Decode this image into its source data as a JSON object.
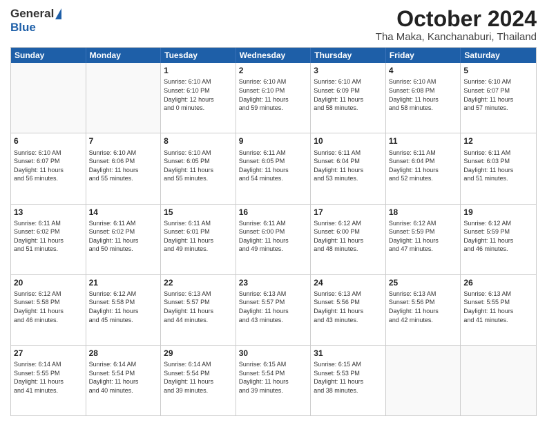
{
  "logo": {
    "general": "General",
    "blue": "Blue"
  },
  "header": {
    "month": "October 2024",
    "location": "Tha Maka, Kanchanaburi, Thailand"
  },
  "weekdays": [
    "Sunday",
    "Monday",
    "Tuesday",
    "Wednesday",
    "Thursday",
    "Friday",
    "Saturday"
  ],
  "weeks": [
    [
      {
        "day": "",
        "info": ""
      },
      {
        "day": "",
        "info": ""
      },
      {
        "day": "1",
        "info": "Sunrise: 6:10 AM\nSunset: 6:10 PM\nDaylight: 12 hours\nand 0 minutes."
      },
      {
        "day": "2",
        "info": "Sunrise: 6:10 AM\nSunset: 6:10 PM\nDaylight: 11 hours\nand 59 minutes."
      },
      {
        "day": "3",
        "info": "Sunrise: 6:10 AM\nSunset: 6:09 PM\nDaylight: 11 hours\nand 58 minutes."
      },
      {
        "day": "4",
        "info": "Sunrise: 6:10 AM\nSunset: 6:08 PM\nDaylight: 11 hours\nand 58 minutes."
      },
      {
        "day": "5",
        "info": "Sunrise: 6:10 AM\nSunset: 6:07 PM\nDaylight: 11 hours\nand 57 minutes."
      }
    ],
    [
      {
        "day": "6",
        "info": "Sunrise: 6:10 AM\nSunset: 6:07 PM\nDaylight: 11 hours\nand 56 minutes."
      },
      {
        "day": "7",
        "info": "Sunrise: 6:10 AM\nSunset: 6:06 PM\nDaylight: 11 hours\nand 55 minutes."
      },
      {
        "day": "8",
        "info": "Sunrise: 6:10 AM\nSunset: 6:05 PM\nDaylight: 11 hours\nand 55 minutes."
      },
      {
        "day": "9",
        "info": "Sunrise: 6:11 AM\nSunset: 6:05 PM\nDaylight: 11 hours\nand 54 minutes."
      },
      {
        "day": "10",
        "info": "Sunrise: 6:11 AM\nSunset: 6:04 PM\nDaylight: 11 hours\nand 53 minutes."
      },
      {
        "day": "11",
        "info": "Sunrise: 6:11 AM\nSunset: 6:04 PM\nDaylight: 11 hours\nand 52 minutes."
      },
      {
        "day": "12",
        "info": "Sunrise: 6:11 AM\nSunset: 6:03 PM\nDaylight: 11 hours\nand 51 minutes."
      }
    ],
    [
      {
        "day": "13",
        "info": "Sunrise: 6:11 AM\nSunset: 6:02 PM\nDaylight: 11 hours\nand 51 minutes."
      },
      {
        "day": "14",
        "info": "Sunrise: 6:11 AM\nSunset: 6:02 PM\nDaylight: 11 hours\nand 50 minutes."
      },
      {
        "day": "15",
        "info": "Sunrise: 6:11 AM\nSunset: 6:01 PM\nDaylight: 11 hours\nand 49 minutes."
      },
      {
        "day": "16",
        "info": "Sunrise: 6:11 AM\nSunset: 6:00 PM\nDaylight: 11 hours\nand 49 minutes."
      },
      {
        "day": "17",
        "info": "Sunrise: 6:12 AM\nSunset: 6:00 PM\nDaylight: 11 hours\nand 48 minutes."
      },
      {
        "day": "18",
        "info": "Sunrise: 6:12 AM\nSunset: 5:59 PM\nDaylight: 11 hours\nand 47 minutes."
      },
      {
        "day": "19",
        "info": "Sunrise: 6:12 AM\nSunset: 5:59 PM\nDaylight: 11 hours\nand 46 minutes."
      }
    ],
    [
      {
        "day": "20",
        "info": "Sunrise: 6:12 AM\nSunset: 5:58 PM\nDaylight: 11 hours\nand 46 minutes."
      },
      {
        "day": "21",
        "info": "Sunrise: 6:12 AM\nSunset: 5:58 PM\nDaylight: 11 hours\nand 45 minutes."
      },
      {
        "day": "22",
        "info": "Sunrise: 6:13 AM\nSunset: 5:57 PM\nDaylight: 11 hours\nand 44 minutes."
      },
      {
        "day": "23",
        "info": "Sunrise: 6:13 AM\nSunset: 5:57 PM\nDaylight: 11 hours\nand 43 minutes."
      },
      {
        "day": "24",
        "info": "Sunrise: 6:13 AM\nSunset: 5:56 PM\nDaylight: 11 hours\nand 43 minutes."
      },
      {
        "day": "25",
        "info": "Sunrise: 6:13 AM\nSunset: 5:56 PM\nDaylight: 11 hours\nand 42 minutes."
      },
      {
        "day": "26",
        "info": "Sunrise: 6:13 AM\nSunset: 5:55 PM\nDaylight: 11 hours\nand 41 minutes."
      }
    ],
    [
      {
        "day": "27",
        "info": "Sunrise: 6:14 AM\nSunset: 5:55 PM\nDaylight: 11 hours\nand 41 minutes."
      },
      {
        "day": "28",
        "info": "Sunrise: 6:14 AM\nSunset: 5:54 PM\nDaylight: 11 hours\nand 40 minutes."
      },
      {
        "day": "29",
        "info": "Sunrise: 6:14 AM\nSunset: 5:54 PM\nDaylight: 11 hours\nand 39 minutes."
      },
      {
        "day": "30",
        "info": "Sunrise: 6:15 AM\nSunset: 5:54 PM\nDaylight: 11 hours\nand 39 minutes."
      },
      {
        "day": "31",
        "info": "Sunrise: 6:15 AM\nSunset: 5:53 PM\nDaylight: 11 hours\nand 38 minutes."
      },
      {
        "day": "",
        "info": ""
      },
      {
        "day": "",
        "info": ""
      }
    ]
  ]
}
